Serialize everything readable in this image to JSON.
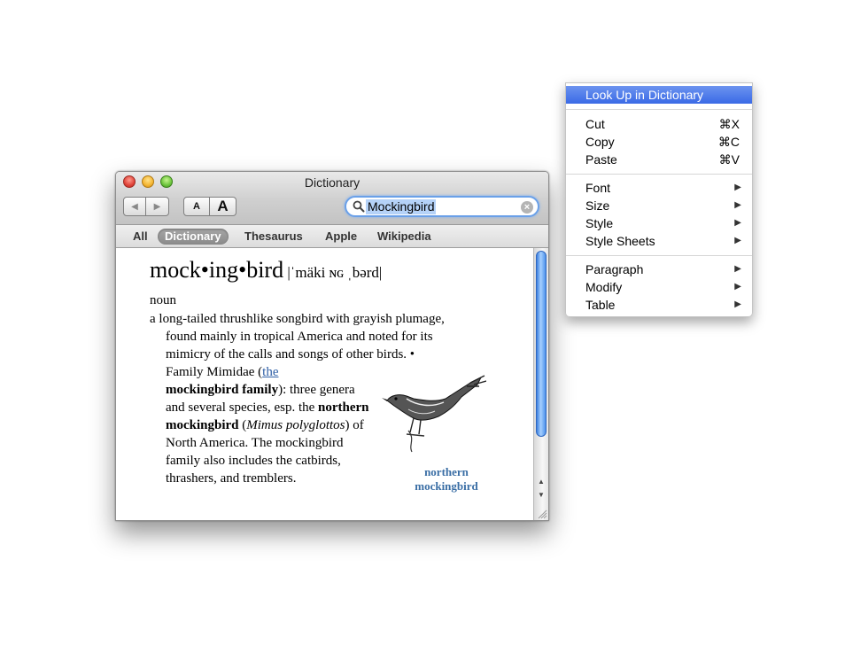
{
  "window": {
    "title": "Dictionary",
    "search_value": "Mockingbird",
    "font_small_label": "A",
    "font_large_label": "A",
    "tabs": [
      {
        "label": "All",
        "selected": false
      },
      {
        "label": "Dictionary",
        "selected": true
      },
      {
        "label": "Thesaurus",
        "selected": false
      },
      {
        "label": "Apple",
        "selected": false
      },
      {
        "label": "Wikipedia",
        "selected": false
      }
    ]
  },
  "entry": {
    "headword": "mock•ing•bird",
    "pronunciation": " |ˈmäki ɴɢ ˌbərd|",
    "part_of_speech": "noun",
    "def_line1": "a long-tailed thrushlike songbird with grayish plumage,",
    "def_line2": "found mainly in tropical America and noted for its",
    "def_line3": "mimicry of the calls and songs of other birds. •",
    "family_pre": "Family Mimidae (",
    "family_link": "the",
    "family_bold": "mockingbird family",
    "family_rest1": "): three genera and several species, esp. the ",
    "species_bold": "northern mockingbird",
    "species_open": " (",
    "species_latin": "Mimus polyglottos",
    "species_rest": ") of North America. The mockingbird family also includes the catbirds, thrashers, and tremblers.",
    "image_caption": "northern mockingbird"
  },
  "menu": {
    "highlighted": "Look Up in Dictionary",
    "groups": [
      [
        {
          "label": "Cut",
          "shortcut": "⌘X"
        },
        {
          "label": "Copy",
          "shortcut": "⌘C"
        },
        {
          "label": "Paste",
          "shortcut": "⌘V"
        }
      ],
      [
        {
          "label": "Font",
          "submenu": true
        },
        {
          "label": "Size",
          "submenu": true
        },
        {
          "label": "Style",
          "submenu": true
        },
        {
          "label": "Style Sheets",
          "submenu": true
        }
      ],
      [
        {
          "label": "Paragraph",
          "submenu": true
        },
        {
          "label": "Modify",
          "submenu": true
        },
        {
          "label": "Table",
          "submenu": true
        }
      ]
    ]
  },
  "colors": {
    "accent": "#3a6ae6",
    "link": "#2e5fa6",
    "caption": "#3a6ea5"
  },
  "icons": {
    "back": "triangle-left-icon",
    "forward": "triangle-right-icon",
    "search": "magnifier-icon",
    "clear": "clear-icon",
    "submenu": "triangle-right-icon"
  }
}
